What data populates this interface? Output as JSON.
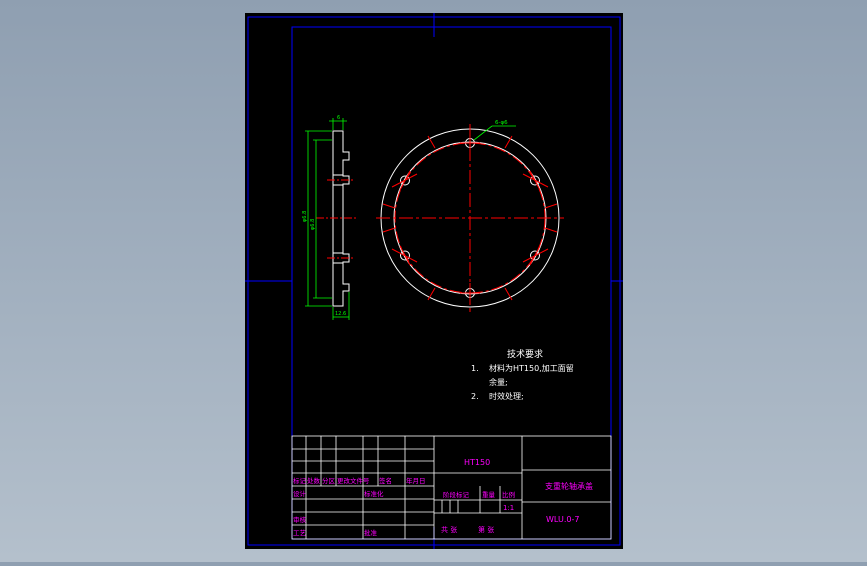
{
  "drawing": {
    "technical_requirements": {
      "title": "技术要求",
      "item1_num": "1.",
      "item1_line1": "材料为HT150,加工面留",
      "item1_line2": "余量;",
      "item2_num": "2.",
      "item2_text": "时效处理;"
    },
    "dimensions": {
      "hole_callout": "6-φ6",
      "width_top": "6",
      "dia_outer": "φ6.8",
      "dia_inner": "φ6.8",
      "width_bottom": "12.6"
    },
    "title_block": {
      "material": "HT150",
      "part_name": "支重轮轴承盖",
      "drawing_number": "WLU.0-7",
      "scale_value": "1:1",
      "header_row": [
        "标记",
        "处数",
        "分区",
        "更改文件号",
        "签名",
        "年月日"
      ],
      "design": "设计",
      "standardization": "标准化",
      "stage_mark": "阶段标记",
      "weight": "重量",
      "scale": "比例",
      "review": "审核",
      "process": "工艺",
      "approve": "批准",
      "sheets_total": "共 张",
      "sheet_no": "第 张"
    },
    "colors": {
      "background": "#000000",
      "frame": "#0000ff",
      "outline": "#ffffff",
      "centerline": "#ff0000",
      "dimension": "#00ff00",
      "table_text": "#ff00ff",
      "note_text": "#ffffff",
      "model_space_bg": "#9aa9ba"
    }
  }
}
